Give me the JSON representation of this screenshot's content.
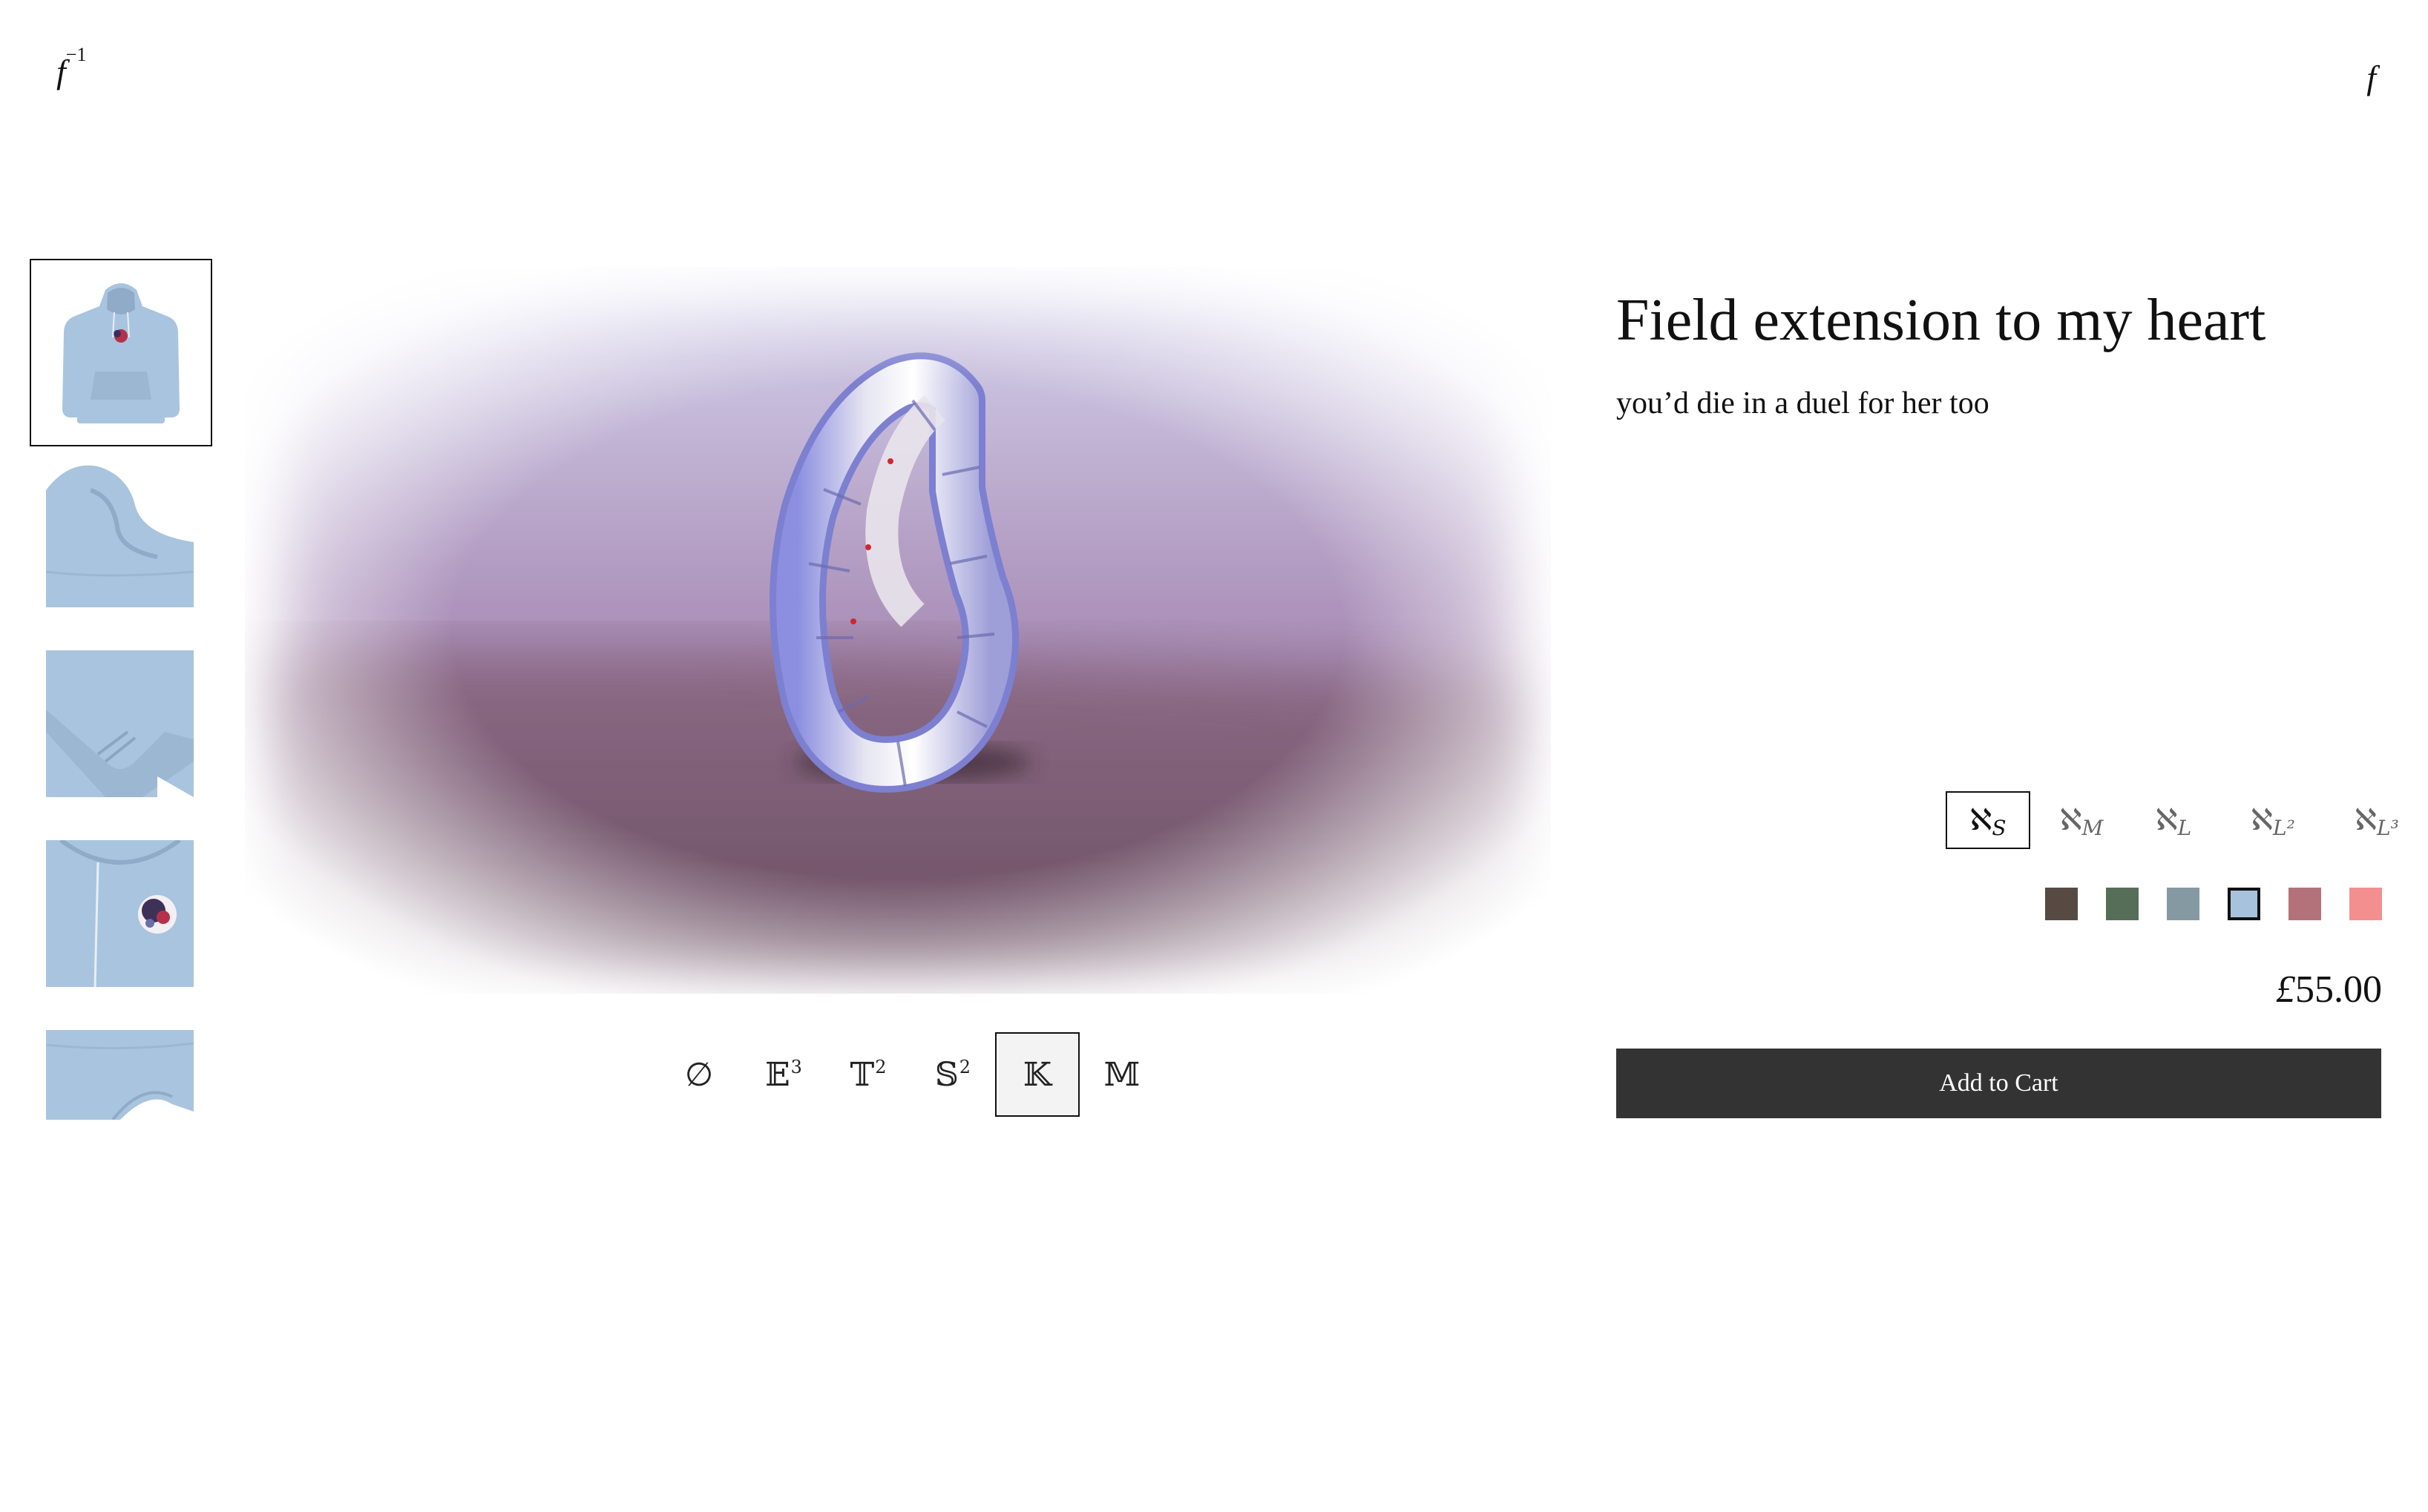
{
  "nav": {
    "left_base": "f",
    "left_sup": "−1",
    "right": "f"
  },
  "gallery": {
    "thumbnails": [
      {
        "name": "hoodie-front",
        "selected": true
      },
      {
        "name": "hoodie-hood-detail",
        "selected": false
      },
      {
        "name": "hoodie-sleeve-cuff",
        "selected": false
      },
      {
        "name": "hoodie-print-detail",
        "selected": false
      },
      {
        "name": "hoodie-hem-detail",
        "selected": false
      }
    ]
  },
  "geometry": {
    "options": [
      {
        "base": "∅",
        "sup": ""
      },
      {
        "base": "𝔼",
        "sup": "3"
      },
      {
        "base": "𝕋",
        "sup": "2"
      },
      {
        "base": "𝕊",
        "sup": "2"
      },
      {
        "base": "𝕂",
        "sup": ""
      },
      {
        "base": "𝕄",
        "sup": ""
      }
    ],
    "selected_index": 4
  },
  "product": {
    "title": "Field extension to my heart",
    "subtitle": "you’d die in a duel for her too",
    "price_currency": "£",
    "price_amount": "55.00",
    "add_to_cart": "Add to Cart"
  },
  "sizes": {
    "options": [
      {
        "base": "ℵ",
        "sub": "S"
      },
      {
        "base": "ℵ",
        "sub": "M"
      },
      {
        "base": "ℵ",
        "sub": "L"
      },
      {
        "base": "ℵ",
        "sub": "L²"
      },
      {
        "base": "ℵ",
        "sub": "L³"
      }
    ],
    "selected_index": 0
  },
  "colors": {
    "options": [
      "#564a43",
      "#566e57",
      "#8499a2",
      "#a7c2dc",
      "#b3717a",
      "#f48f8f"
    ],
    "selected_index": 3
  }
}
